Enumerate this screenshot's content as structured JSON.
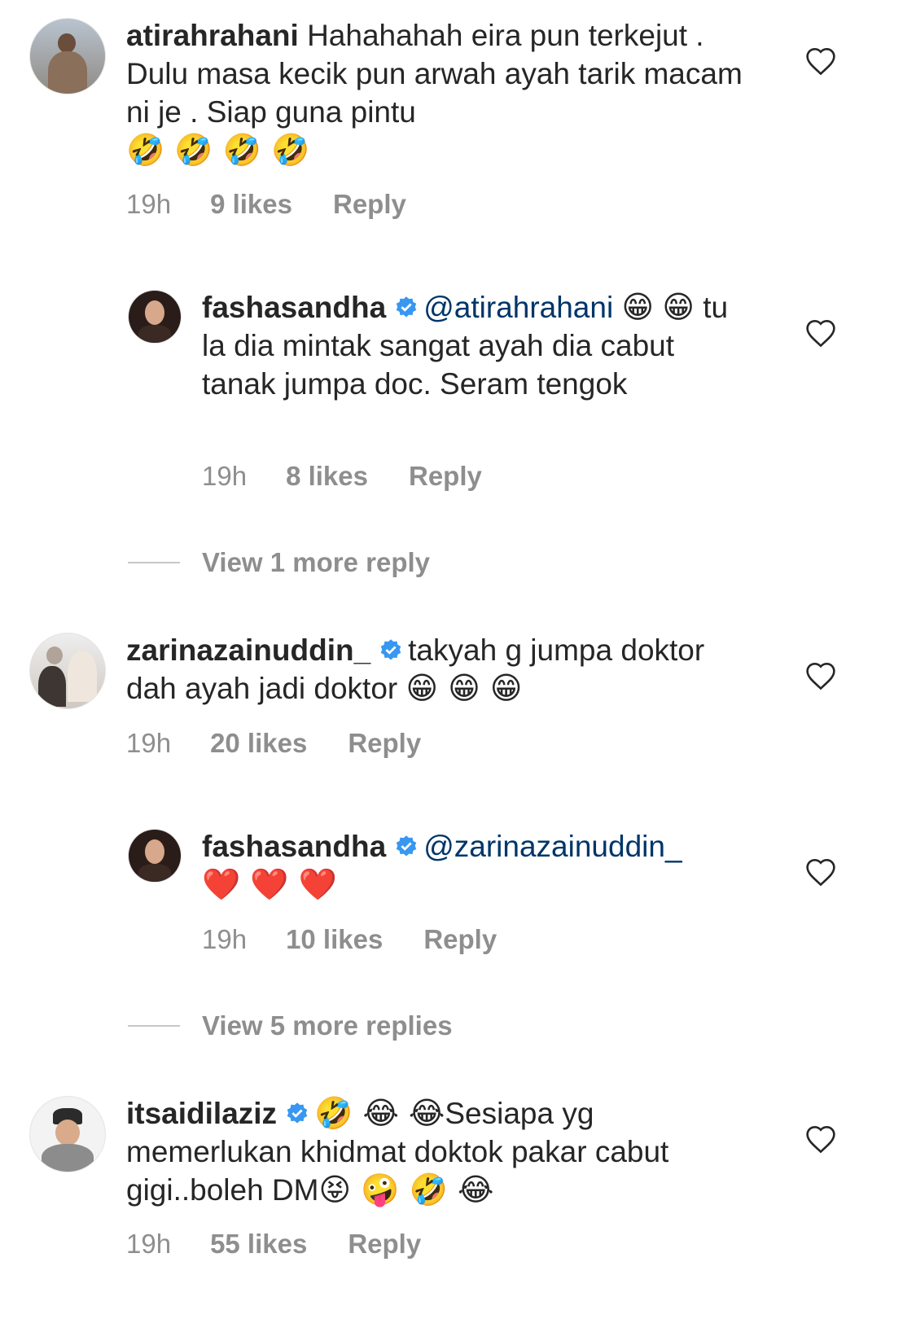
{
  "comments": [
    {
      "username": "atirahrahani",
      "text": "Hahahahah eira pun terkejut . Dulu masa kecik pun arwah ayah tarik macam ni je . Siap guna pintu",
      "emojis": "🤣 🤣 🤣 🤣",
      "time": "19h",
      "likes": "9 likes",
      "reply": "Reply"
    },
    {
      "username": "fashasandha",
      "mention": "@atirahrahani",
      "emoji_lead": "😁",
      "emoji_line2": "😁",
      "text": "tu la dia mintak sangat ayah dia cabut tanak jumpa doc. Seram tengok",
      "time": "19h",
      "likes": "8 likes",
      "reply": "Reply"
    },
    {
      "username": "zarinazainuddin_",
      "text": "takyah g jumpa doktor dah ayah jadi doktor",
      "emojis": "😁 😁 😁",
      "time": "19h",
      "likes": "20 likes",
      "reply": "Reply"
    },
    {
      "username": "fashasandha",
      "mention": "@zarinazainuddin_",
      "emojis": "❤️ ❤️ ❤️",
      "time": "19h",
      "likes": "10 likes",
      "reply": "Reply"
    },
    {
      "username": "itsaidilaziz",
      "emoji_lead": "🤣 😂  😂",
      "text": "Sesiapa yg memerlukan khidmat doktok pakar cabut gigi..boleh DM",
      "emojis": "😝 🤪 🤣 😂",
      "time": "19h",
      "likes": "55 likes",
      "reply": "Reply"
    }
  ],
  "view_more": {
    "first": "View 1 more reply",
    "second": "View 5 more replies"
  },
  "icons": {
    "verified": "verified-badge-icon",
    "heart": "heart-outline-icon",
    "verified_color": "#3897f0"
  }
}
